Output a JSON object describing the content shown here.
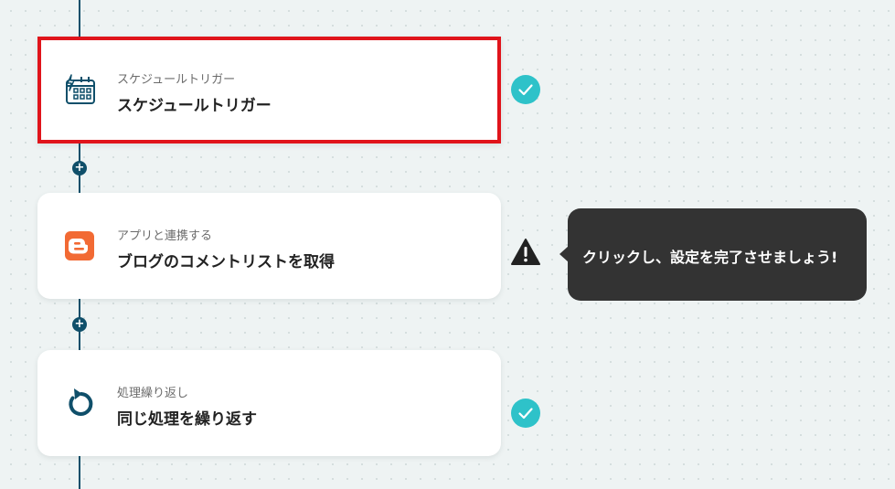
{
  "flow": {
    "steps": [
      {
        "category": "スケジュールトリガー",
        "title": "スケジュールトリガー",
        "icon": "schedule-calendar-icon",
        "status": "complete",
        "selected": true
      },
      {
        "category": "アプリと連携する",
        "title": "ブログのコメントリストを取得",
        "icon": "blogger-icon",
        "status": "warning",
        "selected": false
      },
      {
        "category": "処理繰り返し",
        "title": "同じ処理を繰り返す",
        "icon": "repeat-icon",
        "status": "complete",
        "selected": false
      }
    ],
    "add_step_symbol": "+"
  },
  "tooltip": {
    "text": "クリックし、設定を完了させましょう!"
  },
  "colors": {
    "flow_line": "#0f4f6a",
    "selected_border": "#e0141b",
    "check_badge": "#2ec2c9",
    "warning": "#222222",
    "blogger": "#f26a34",
    "tooltip_bg": "#333333"
  }
}
